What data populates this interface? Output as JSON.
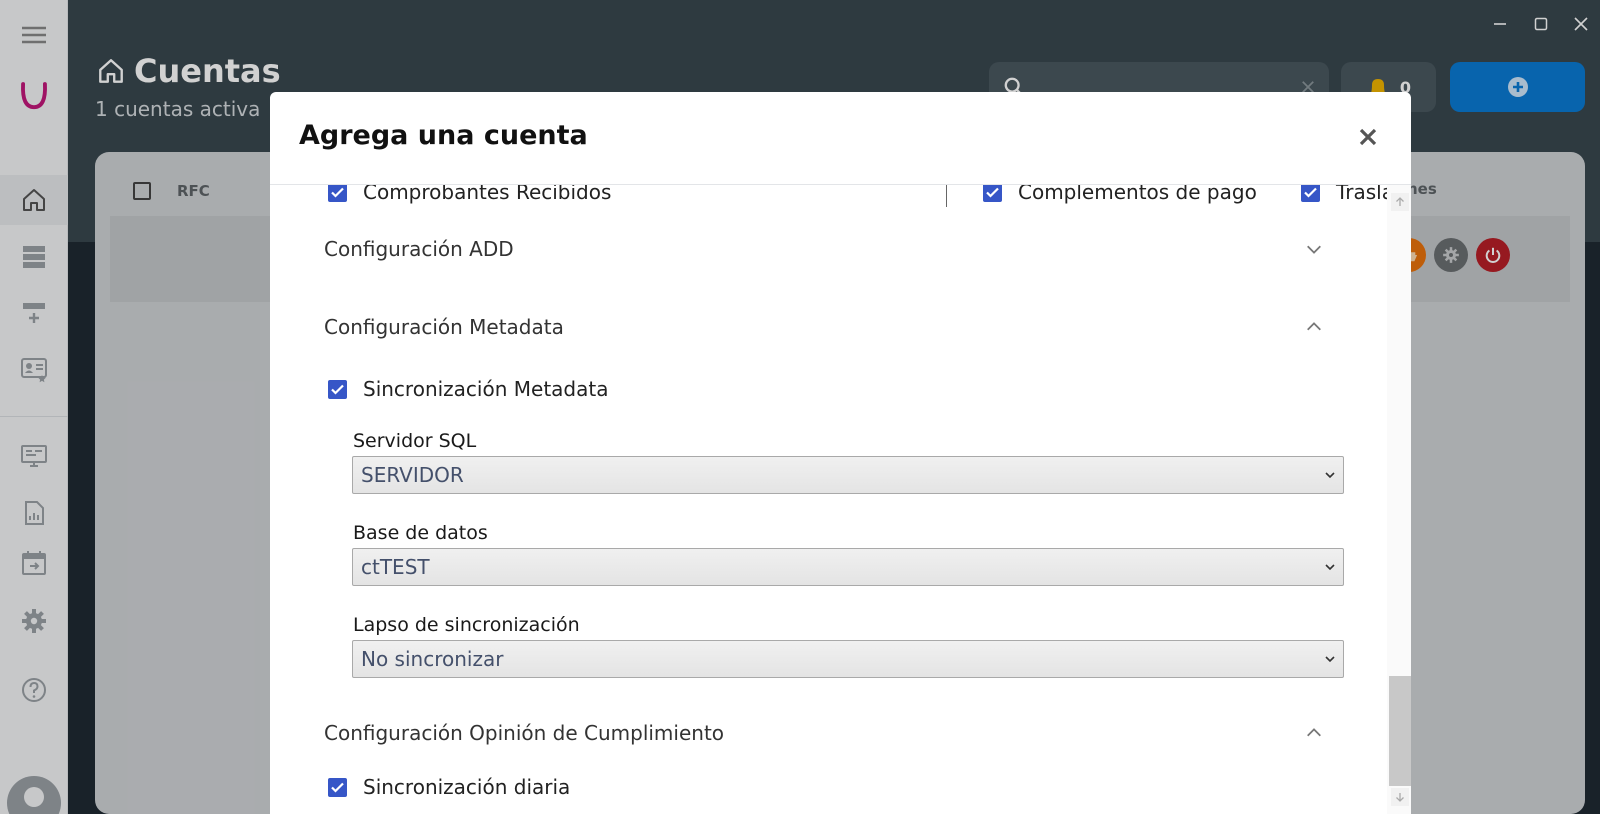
{
  "window": {
    "minimize_label": "minimize",
    "maximize_label": "maximize",
    "close_label": "close"
  },
  "sidebar": {
    "items": [
      {
        "name": "home"
      },
      {
        "name": "accounts-list"
      },
      {
        "name": "add-account"
      },
      {
        "name": "contacts"
      },
      {
        "name": "monitor"
      },
      {
        "name": "reports"
      },
      {
        "name": "calendar"
      },
      {
        "name": "settings"
      },
      {
        "name": "help"
      }
    ]
  },
  "header": {
    "title": "Cuentas",
    "subtitle": "1 cuentas activa",
    "notification_count": "0"
  },
  "table": {
    "col_rfc": "RFC",
    "col_actions_partial": "nes"
  },
  "modal": {
    "title": "Agrega una cuenta",
    "top_checks": [
      {
        "label": "Comprobantes Recibidos",
        "checked": true
      },
      {
        "label": "Complementos de pago",
        "checked": true
      },
      {
        "label": "Traslados",
        "checked": true
      }
    ],
    "sections": {
      "add": {
        "label": "Configuración ADD",
        "expanded": false
      },
      "metadata": {
        "label": "Configuración Metadata",
        "expanded": true
      },
      "opinion": {
        "label": "Configuración Opinión de Cumplimiento",
        "expanded": true
      }
    },
    "metadata": {
      "sync_label": "Sincronización Metadata",
      "server_label": "Servidor SQL",
      "server_value": "SERVIDOR",
      "db_label": "Base de datos",
      "db_value": "ctTEST",
      "interval_label": "Lapso de sincronización",
      "interval_value": "No sincronizar"
    },
    "opinion": {
      "sync_label": "Sincronización diaria"
    }
  },
  "colors": {
    "titlebar": "#39474f",
    "accent_blue": "#0a7bd4",
    "checkbox": "#3656c7",
    "brand_logo": "#c2187a"
  }
}
